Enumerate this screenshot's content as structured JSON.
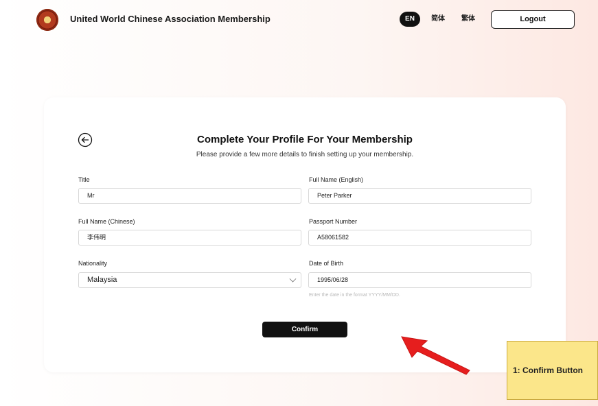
{
  "header": {
    "app_title": "United World Chinese Association Membership",
    "languages": [
      "EN",
      "简体",
      "繁体"
    ],
    "active_language": "EN",
    "logout_label": "Logout"
  },
  "form": {
    "title": "Complete Your Profile For Your Membership",
    "subtitle": "Please provide a few more details to finish setting up your membership.",
    "fields": {
      "title": {
        "label": "Title",
        "value": "Mr"
      },
      "full_name_english": {
        "label": "Full Name (English)",
        "value": "Peter Parker"
      },
      "full_name_chinese": {
        "label": "Full Name (Chinese)",
        "value": "李伟明"
      },
      "passport_number": {
        "label": "Passport Number",
        "value": "A58061582"
      },
      "nationality": {
        "label": "Nationality",
        "value": "Malaysia"
      },
      "date_of_birth": {
        "label": "Date of Birth",
        "value": "1995/06/28",
        "hint": "Enter the date in the format YYYY/MM/DD."
      }
    },
    "confirm_label": "Confirm"
  },
  "annotation": {
    "label": "1: Confirm Button",
    "color": "#fbe68a",
    "arrow_color": "#e61e1e"
  },
  "icons": {
    "back": "arrow-left-circle-icon",
    "dropdown": "chevron-down-icon",
    "logo": "association-emblem"
  }
}
